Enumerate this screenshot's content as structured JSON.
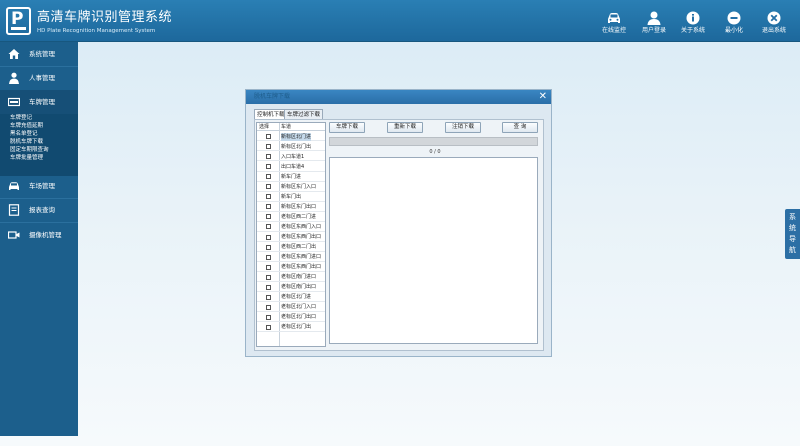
{
  "header": {
    "title": "高清车牌识别管理系统",
    "subtitle": "HD Plate Recognition Management System",
    "logo_letter": "P",
    "buttons": [
      {
        "label": "在线监控",
        "icon": "car-icon"
      },
      {
        "label": "用户登录",
        "icon": "user-icon"
      },
      {
        "label": "关于系统",
        "icon": "info-icon"
      },
      {
        "label": "最小化",
        "icon": "minimize-icon"
      },
      {
        "label": "退出系统",
        "icon": "close-icon"
      }
    ]
  },
  "sidebar": {
    "items": [
      {
        "label": "系统管理",
        "icon": "home-icon"
      },
      {
        "label": "人事管理",
        "icon": "person-icon"
      },
      {
        "label": "车牌管理",
        "icon": "plate-icon"
      },
      {
        "label": "车场管理",
        "icon": "car-icon"
      },
      {
        "label": "报表查询",
        "icon": "report-icon"
      },
      {
        "label": "摄像机管理",
        "icon": "camera-icon"
      }
    ],
    "submenu": [
      "车牌登记",
      "车牌充值延期",
      "黑名单登记",
      "脱机车牌下载",
      "固定车期限查询",
      "车牌批量管理"
    ]
  },
  "side_nav": [
    "系",
    "统",
    "导",
    "航"
  ],
  "dialog": {
    "title": "脱机车牌下载",
    "tabs": [
      "控制机下载",
      "车牌过滤下载"
    ],
    "table_headers": [
      "选择",
      "车道"
    ],
    "lanes": [
      "新标区北门进",
      "新标区北门出",
      "入口车道1",
      "出口车道4",
      "新车门进",
      "新标区东门入口",
      "新车门出",
      "新标区东门出口",
      "老标区西二门进",
      "老标区东西门入口",
      "老标区东西门出口",
      "老标区西二门出",
      "老标区东西门进口",
      "老标区东西门出口",
      "老标区南门进口",
      "老标区南门出口",
      "老标区北门进",
      "老标区北门入口",
      "老标区北门出口",
      "老标区北门出"
    ],
    "buttons": {
      "download": "车牌下载",
      "redownload": "重新下载",
      "delete_download": "注销下载",
      "query": "查  询"
    },
    "progress_text": "0 / 0"
  }
}
